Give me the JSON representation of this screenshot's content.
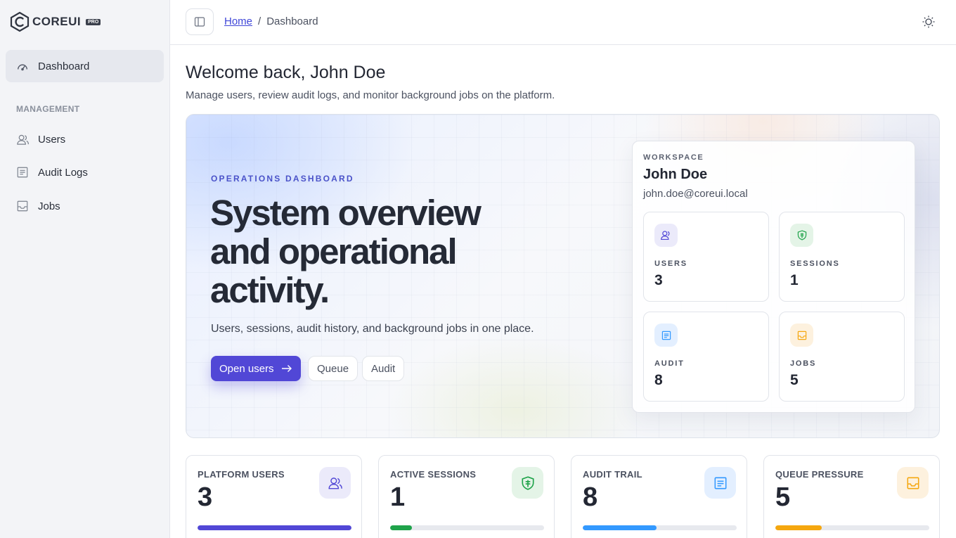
{
  "brand": {
    "name": "COREUI",
    "badge": "PRO"
  },
  "sidebar": {
    "dashboard_label": "Dashboard",
    "section_title": "MANAGEMENT",
    "items": [
      {
        "label": "Users",
        "icon": "users-icon"
      },
      {
        "label": "Audit Logs",
        "icon": "document-icon"
      },
      {
        "label": "Jobs",
        "icon": "inbox-icon"
      }
    ]
  },
  "header": {
    "home_link": "Home",
    "separator": "/",
    "current": "Dashboard"
  },
  "welcome": {
    "title": "Welcome back, John Doe",
    "subtitle": "Manage users, review audit logs, and monitor background jobs on the platform."
  },
  "hero": {
    "eyebrow": "OPERATIONS DASHBOARD",
    "title": "System overview and operational activity.",
    "subtitle": "Users, sessions, audit history, and background jobs in one place.",
    "primary_button": "Open users",
    "queue_button": "Queue",
    "audit_button": "Audit"
  },
  "workspace": {
    "label": "WORKSPACE",
    "name": "John Doe",
    "email": "john.doe@coreui.local",
    "tiles": [
      {
        "label": "USERS",
        "value": "3",
        "icon": "users-icon"
      },
      {
        "label": "SESSIONS",
        "value": "1",
        "icon": "shield-icon"
      },
      {
        "label": "AUDIT",
        "value": "8",
        "icon": "document-icon"
      },
      {
        "label": "JOBS",
        "value": "5",
        "icon": "inbox-icon"
      }
    ]
  },
  "stats": [
    {
      "label": "PLATFORM USERS",
      "value": "3",
      "icon": "users-icon",
      "progress": 1.0,
      "color": "#5147d6"
    },
    {
      "label": "ACTIVE SESSIONS",
      "value": "1",
      "icon": "shield-icon",
      "progress": 0.14,
      "color": "#1fa34a"
    },
    {
      "label": "AUDIT TRAIL",
      "value": "8",
      "icon": "document-icon",
      "progress": 0.48,
      "color": "#3399ff"
    },
    {
      "label": "QUEUE PRESSURE",
      "value": "5",
      "icon": "inbox-icon",
      "progress": 0.3,
      "color": "#f5a70f"
    }
  ],
  "colors": {
    "accent": "#5147d6",
    "green": "#1fa34a",
    "blue": "#3399ff",
    "amber": "#f5a70f"
  }
}
